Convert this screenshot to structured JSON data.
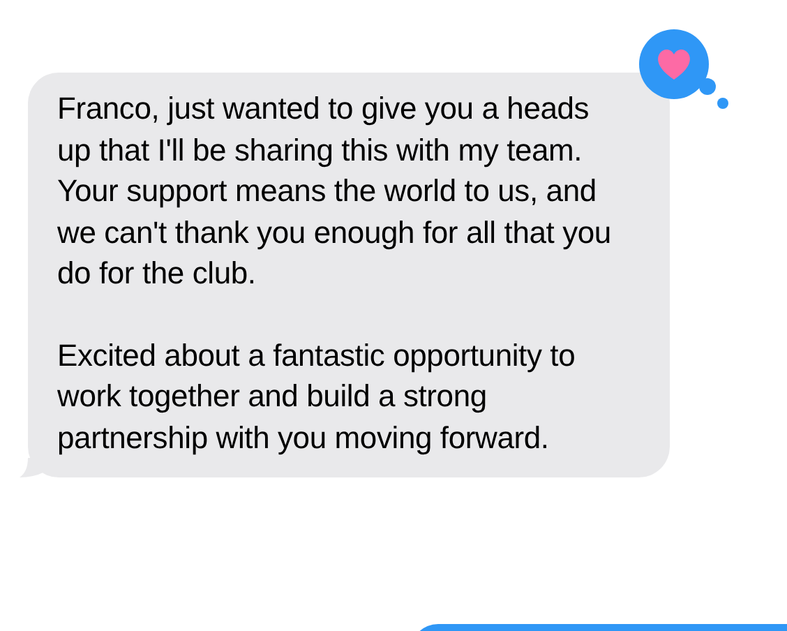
{
  "message": {
    "paragraphs": [
      "Franco, just wanted to give you a heads up that I'll be sharing this with my team. Your support means the world to us, and we can't thank you enough for all that you do for the club.",
      "Excited about a fantastic opportunity to work together and build a strong partnership with you moving forward."
    ],
    "reaction": {
      "kind": "heart"
    }
  }
}
